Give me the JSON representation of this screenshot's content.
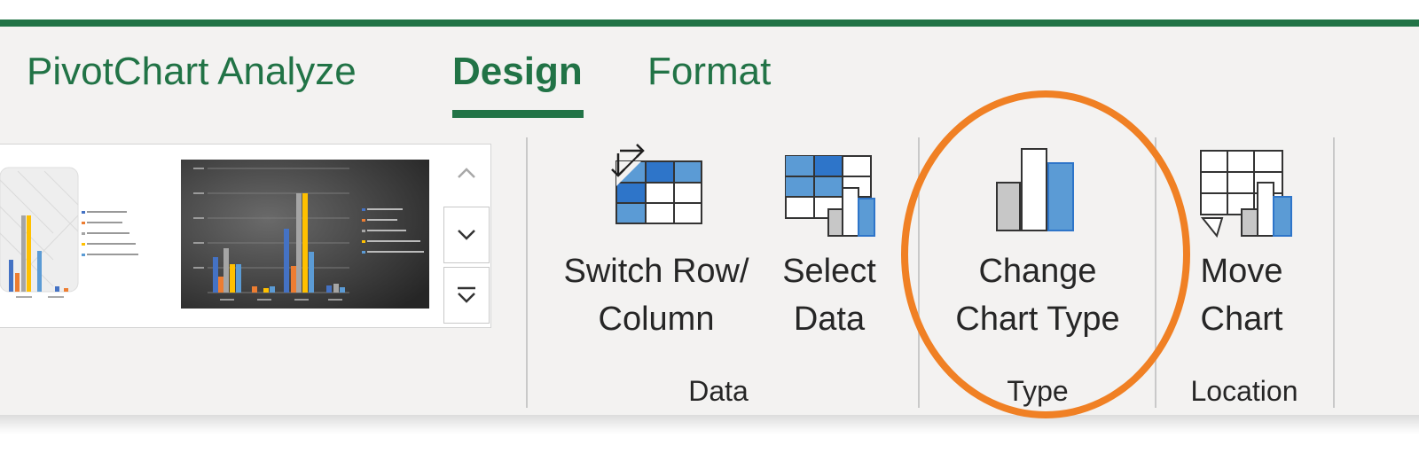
{
  "tabs": [
    {
      "label": "PivotChart Analyze"
    },
    {
      "label": "Design"
    },
    {
      "label": "Format"
    }
  ],
  "active_tab": "Design",
  "groups": {
    "data": {
      "label": "Data",
      "buttons": [
        {
          "label_line1": "Switch Row/",
          "label_line2": "Column",
          "icon": "switch-row-column-icon"
        },
        {
          "label_line1": "Select",
          "label_line2": "Data",
          "icon": "select-data-icon"
        }
      ]
    },
    "type": {
      "label": "Type",
      "buttons": [
        {
          "label_line1": "Change",
          "label_line2": "Chart Type",
          "icon": "change-chart-type-icon"
        }
      ]
    },
    "location": {
      "label": "Location",
      "buttons": [
        {
          "label_line1": "Move",
          "label_line2": "Chart",
          "icon": "move-chart-icon"
        }
      ]
    }
  },
  "colors": {
    "accent": "#217346",
    "highlight": "#f08024",
    "icon_blue": "#2e75c9",
    "icon_light_blue": "#9cc3e6"
  }
}
